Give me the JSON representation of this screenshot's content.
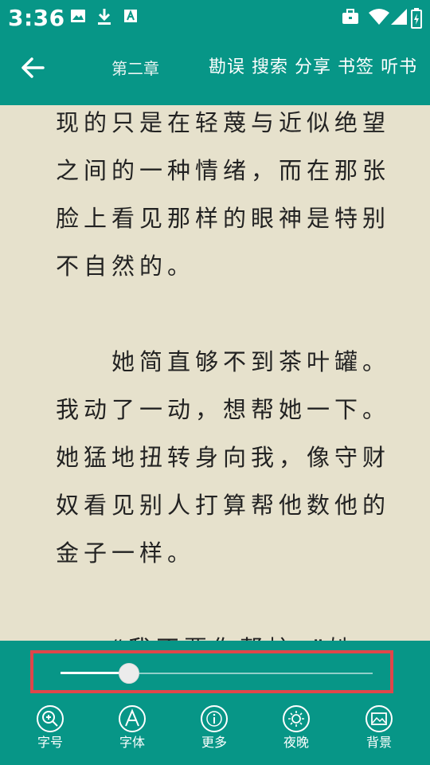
{
  "status_bar": {
    "time": "3:36",
    "left_icons": [
      "image-icon",
      "download-icon",
      "a-box-icon"
    ],
    "right_icons": [
      "briefcase-icon",
      "wifi-icon",
      "signal-icon",
      "battery-icon"
    ]
  },
  "app_bar": {
    "chapter": "第二章",
    "actions": [
      "勘误",
      "搜索",
      "分享",
      "书签",
      "听书"
    ]
  },
  "content": {
    "paragraphs": [
      "现的只是在轻蔑与近似绝望之间的一种情绪，而在那张脸上看见那样的眼神是特别不自然的。",
      "　　她简直够不到茶叶罐。我动了一动，想帮她一下。她猛地扭转身向我，像守财奴看见别人打算帮他数他的金子一样。",
      "　　“我不要你帮忙，”她"
    ]
  },
  "slider": {
    "value_fraction": 0.22
  },
  "toolbar": {
    "items": [
      {
        "label": "字号",
        "icon": "zoom-in-icon"
      },
      {
        "label": "字体",
        "icon": "font-a-icon"
      },
      {
        "label": "更多",
        "icon": "info-icon"
      },
      {
        "label": "夜晚",
        "icon": "sun-icon"
      },
      {
        "label": "背景",
        "icon": "image-icon"
      }
    ]
  },
  "colors": {
    "primary": "#079687",
    "page_background": "#e6e1cc",
    "highlight": "#e0464a"
  }
}
